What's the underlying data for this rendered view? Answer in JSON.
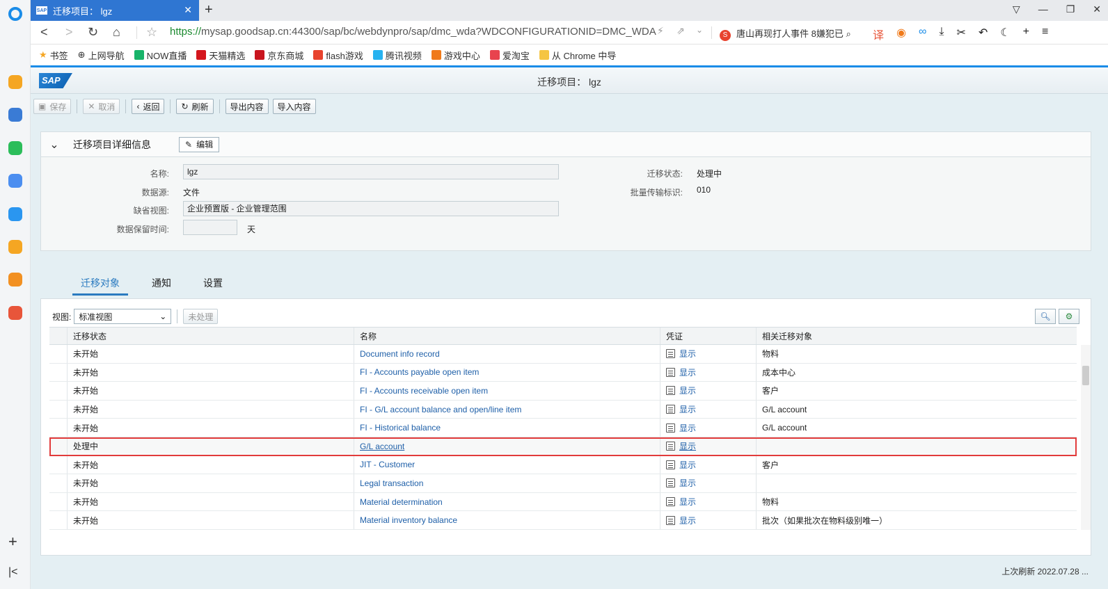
{
  "browser": {
    "tab_title": "迁移项目： lgz",
    "tab_favicon": "SAP",
    "url_scheme": "https://",
    "url_rest": "mysap.goodsap.cn:44300/sap/bc/webdynpro/sap/dmc_wda?WDCONFIGURATIONID=DMC_WDA",
    "news_text": "唐山再现打人事件 8嫌犯已",
    "bookmarks": [
      "书签",
      "上网导航",
      "NOW直播",
      "天猫精选",
      "京东商城",
      "flash游戏",
      "腾讯视频",
      "游戏中心",
      "爱淘宝",
      "从 Chrome 中导"
    ]
  },
  "sap": {
    "page_title": "迁移项目： lgz",
    "toolbar": {
      "save": "保存",
      "cancel": "取消",
      "back": "返回",
      "refresh": "刷新",
      "export": "导出内容",
      "import": "导入内容"
    },
    "details": {
      "title": "迁移项目详细信息",
      "edit": "编辑",
      "name_label": "名称:",
      "name_value": "lgz",
      "source_label": "数据源:",
      "source_value": "文件",
      "default_view_label": "缺省视图:",
      "default_view_value": "企业预置版 - 企业管理范围",
      "retention_label": "数据保留时间:",
      "retention_value": "",
      "retention_unit": "天",
      "status_label": "迁移状态:",
      "status_value": "处理中",
      "transport_label": "批量传输标识:",
      "transport_value": "010"
    },
    "tabs": [
      "迁移对象",
      "通知",
      "设置"
    ],
    "table_tools": {
      "view_label": "视图:",
      "view_value": "标准视图",
      "unprocessed": "未处理"
    },
    "columns": [
      "迁移状态",
      "名称",
      "凭证",
      "相关迁移对象"
    ],
    "rows": [
      {
        "status": "未开始",
        "name": "Document info record",
        "doc": "显示",
        "related": "物料"
      },
      {
        "status": "未开始",
        "name": "FI - Accounts payable open item",
        "doc": "显示",
        "related": "成本中心"
      },
      {
        "status": "未开始",
        "name": "FI - Accounts receivable open item",
        "doc": "显示",
        "related": "客户"
      },
      {
        "status": "未开始",
        "name": "FI - G/L account balance and open/line item",
        "doc": "显示",
        "related": "G/L account"
      },
      {
        "status": "未开始",
        "name": "FI - Historical balance",
        "doc": "显示",
        "related": "G/L account"
      },
      {
        "status": "处理中",
        "name": "G/L account",
        "doc": "显示",
        "related": ""
      },
      {
        "status": "未开始",
        "name": "JIT - Customer",
        "doc": "显示",
        "related": "客户"
      },
      {
        "status": "未开始",
        "name": "Legal transaction",
        "doc": "显示",
        "related": ""
      },
      {
        "status": "未开始",
        "name": "Material determination",
        "doc": "显示",
        "related": "物料"
      },
      {
        "status": "未开始",
        "name": "Material inventory balance",
        "doc": "显示",
        "related": "批次（如果批次在物料级别唯一）"
      }
    ],
    "footer": "上次刷新 2022.07.28 ..."
  }
}
